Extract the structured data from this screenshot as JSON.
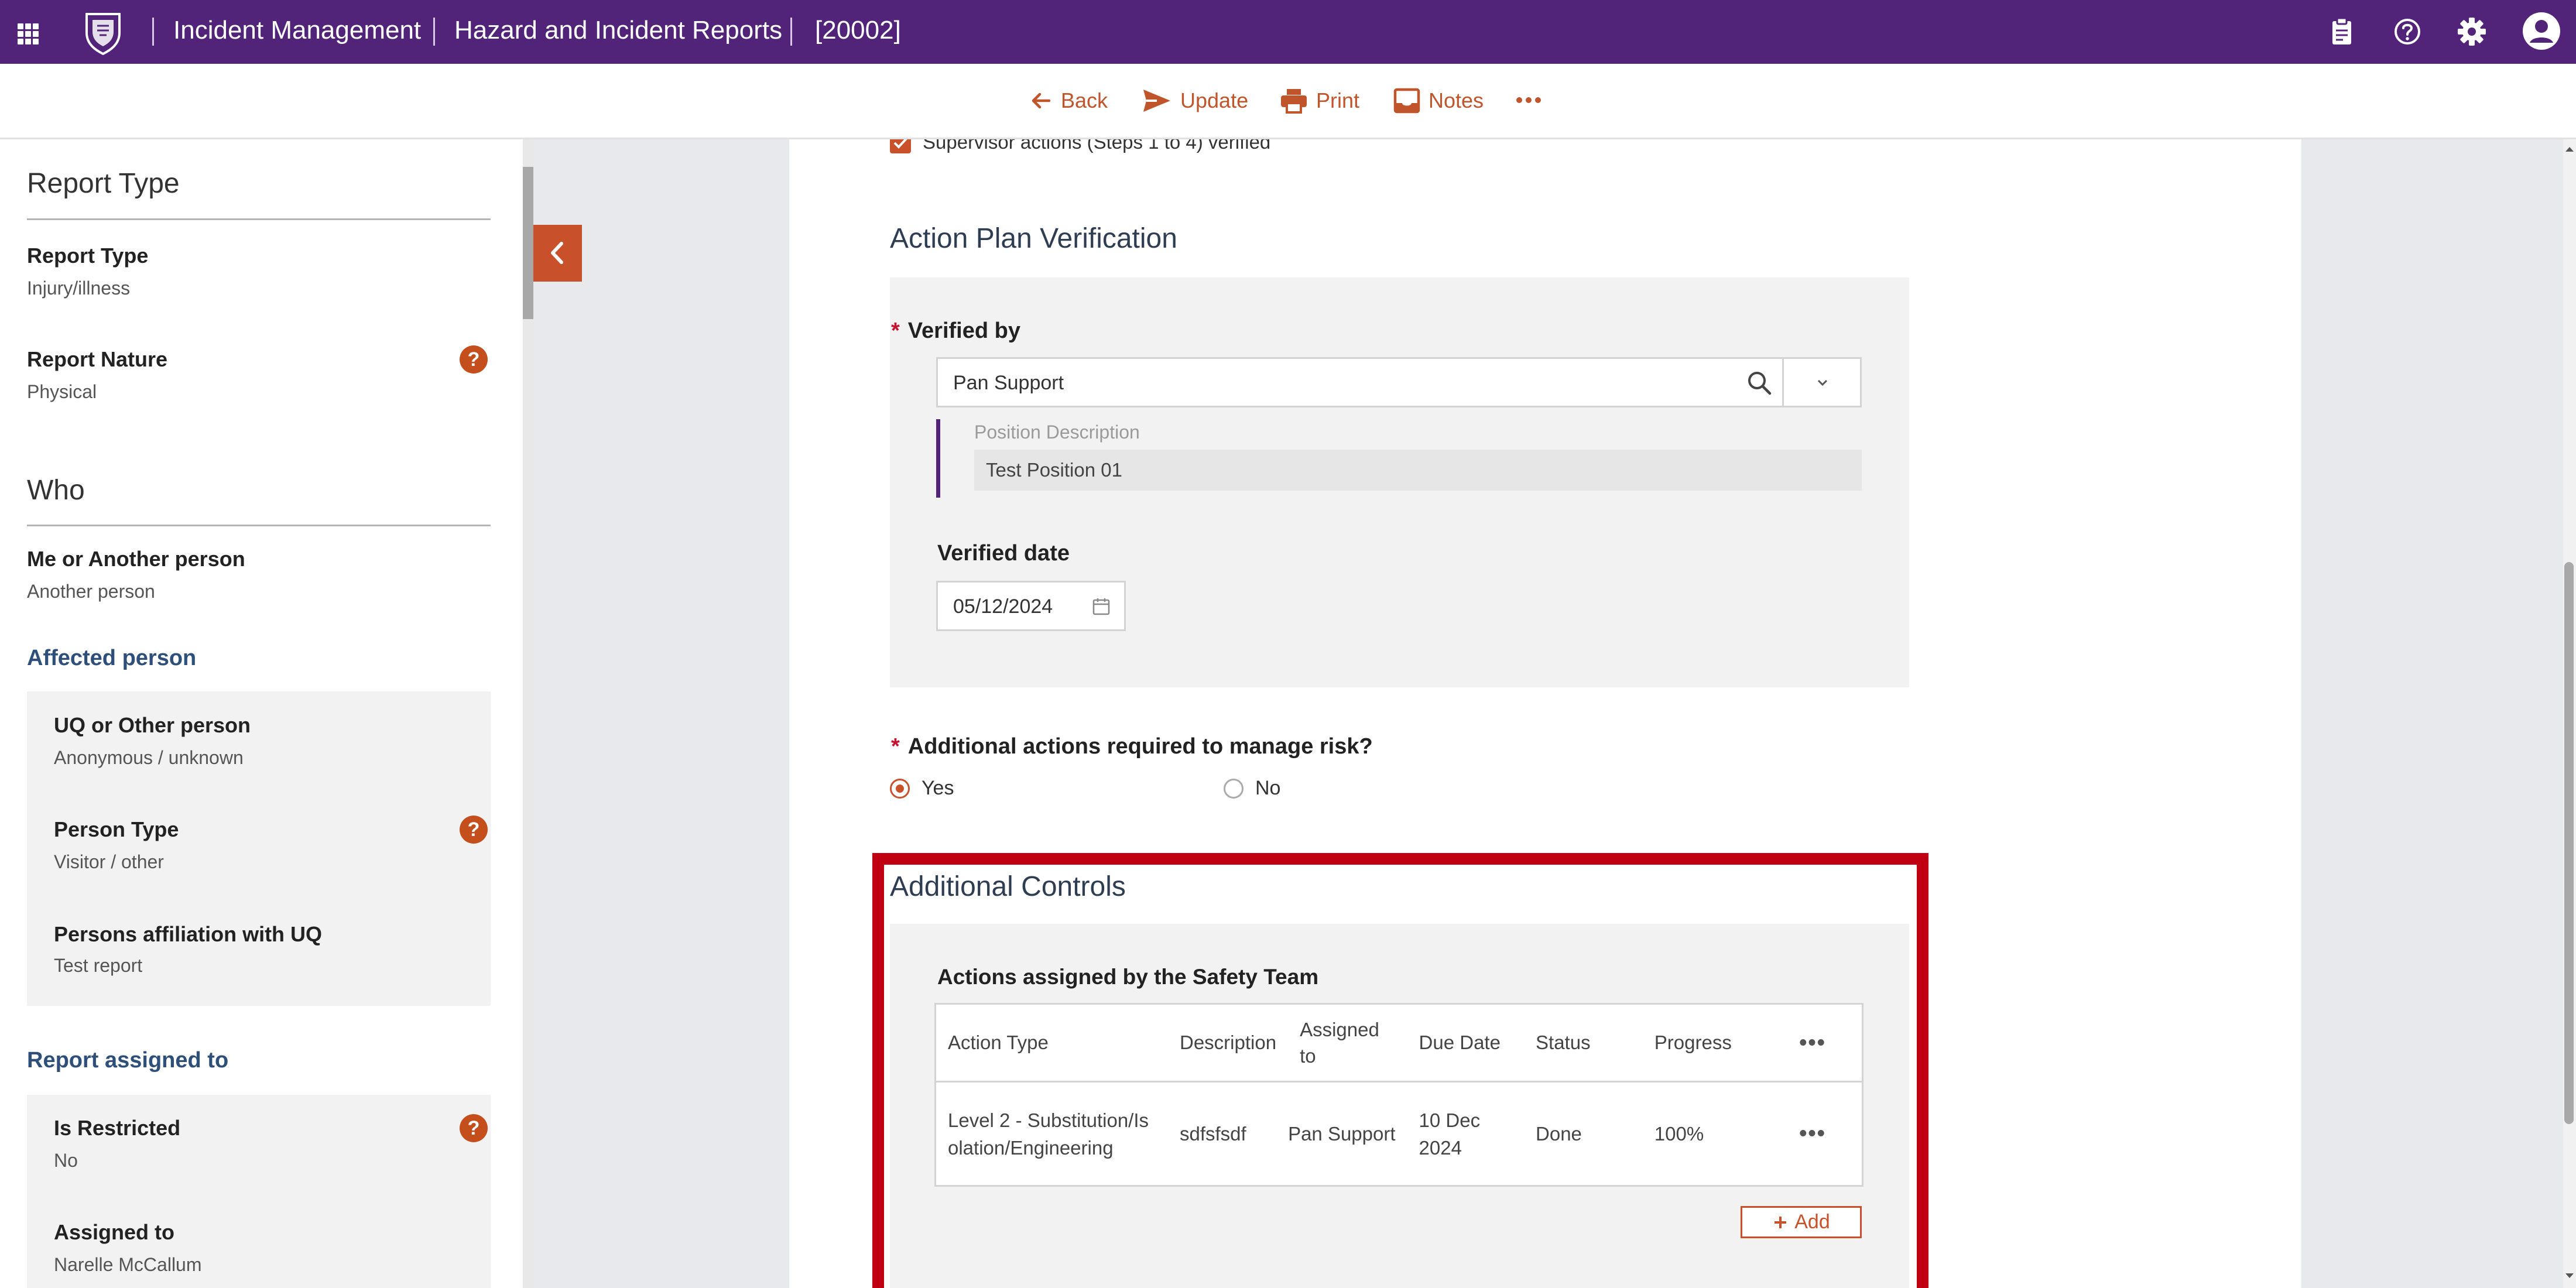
{
  "header": {
    "app_title": "Incident Management",
    "module_title": "Hazard and Incident Reports",
    "record_id": "[20002]"
  },
  "toolbar": {
    "back_label": "Back",
    "update_label": "Update",
    "print_label": "Print",
    "notes_label": "Notes"
  },
  "sidebar": {
    "report_type_heading": "Report Type",
    "report_type_label": "Report Type",
    "report_type_value": "Injury/illness",
    "report_nature_label": "Report Nature",
    "report_nature_value": "Physical",
    "who_heading": "Who",
    "me_or_another_label": "Me or Another person",
    "me_or_another_value": "Another person",
    "affected_person_heading": "Affected person",
    "uq_or_other_label": "UQ or Other person",
    "uq_or_other_value": "Anonymous / unknown",
    "person_type_label": "Person Type",
    "person_type_value": "Visitor / other",
    "affiliation_label": "Persons affiliation with UQ",
    "affiliation_value": "Test report",
    "report_assigned_heading": "Report assigned to",
    "is_restricted_label": "Is Restricted",
    "is_restricted_value": "No",
    "assigned_to_label": "Assigned to",
    "assigned_to_value": "Narelle McCallum",
    "help_glyph": "?"
  },
  "main": {
    "supervisor_checkbox_label": "Supervisor actions (Steps 1 to 4) verified",
    "action_plan_title": "Action Plan Verification",
    "verified_by_label": "Verified by",
    "verified_by_value": "Pan Support",
    "position_description_label": "Position Description",
    "position_description_value": "Test Position 01",
    "verified_date_label": "Verified date",
    "verified_date_value": "05/12/2024",
    "required_mark": "*",
    "additional_actions_question": "Additional actions required to manage risk?",
    "option_yes": "Yes",
    "option_no": "No",
    "additional_controls_title": "Additional Controls",
    "actions_table_title": "Actions assigned by the Safety Team",
    "table_columns": {
      "action_type": "Action Type",
      "description": "Description",
      "assigned_to": "Assigned to",
      "due_date": "Due Date",
      "status": "Status",
      "progress": "Progress"
    },
    "table_rows": [
      {
        "action_type": "Level 2 - Substitution/Isolation/Engineering",
        "description": "sdfsfsdf",
        "assigned_to": "Pan Support",
        "due_date": "10 Dec 2024",
        "status": "Done",
        "progress": "100%"
      }
    ],
    "add_label": "Add"
  },
  "colors": {
    "brand_purple": "#51247a",
    "accent_orange": "#c8502a",
    "highlight_red": "#c00012",
    "help_orange": "#c44f1d"
  }
}
